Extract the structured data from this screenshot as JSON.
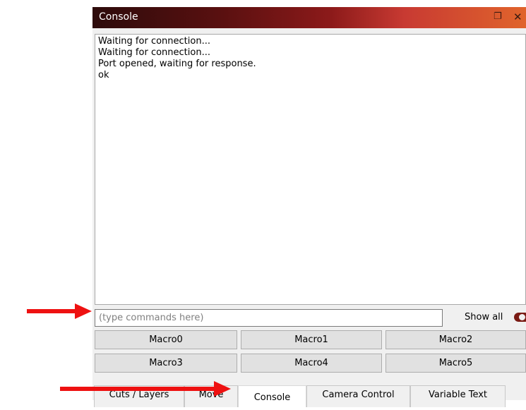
{
  "window": {
    "title": "Console"
  },
  "console": {
    "lines": [
      "Waiting for connection...",
      "Waiting for connection...",
      "Port opened, waiting for response.",
      "ok"
    ]
  },
  "command": {
    "value": "",
    "placeholder": "(type commands here)",
    "show_all_label": "Show all",
    "show_all_on": true
  },
  "macros": [
    "Macro0",
    "Macro1",
    "Macro2",
    "Macro3",
    "Macro4",
    "Macro5"
  ],
  "tabs": [
    {
      "label": "Cuts / Layers",
      "active": false
    },
    {
      "label": "Move",
      "active": false
    },
    {
      "label": "Console",
      "active": true
    },
    {
      "label": "Camera Control",
      "active": false
    },
    {
      "label": "Variable Text",
      "active": false
    }
  ],
  "colors": {
    "titlebar_start": "#2d0b0b",
    "titlebar_end": "#e0642c",
    "arrow": "#ee1111",
    "toggle": "#7a1b14"
  },
  "icons": {
    "float": "restore-window-icon",
    "close": "close-icon",
    "annotation": "red-arrow"
  }
}
